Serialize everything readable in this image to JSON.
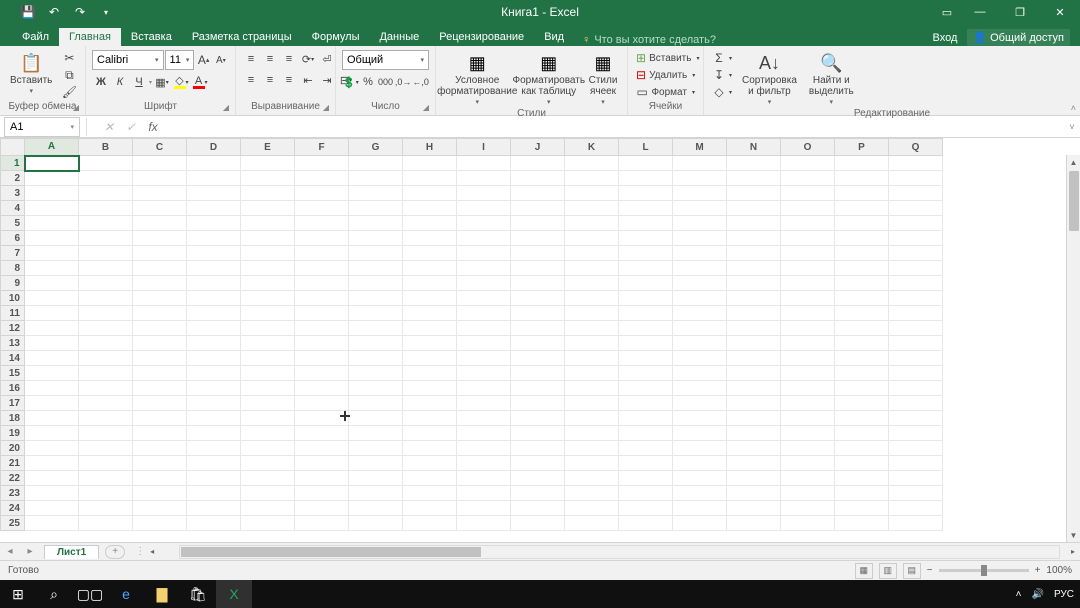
{
  "title": "Книга1 - Excel",
  "qat": {
    "save": "💾",
    "undo": "↶",
    "redo": "↷"
  },
  "win": {
    "ribbon_display": "▭",
    "min": "—",
    "max": "❐",
    "close": "✕"
  },
  "tabs": {
    "file": "Файл",
    "home": "Главная",
    "insert": "Вставка",
    "layout": "Разметка страницы",
    "formulas": "Формулы",
    "data": "Данные",
    "review": "Рецензирование",
    "view": "Вид"
  },
  "tell_me": "Что вы хотите сделать?",
  "signin": "Вход",
  "share": "Общий доступ",
  "ribbon": {
    "clipboard": {
      "paste": "Вставить",
      "cut": "",
      "copy": "",
      "format_painter": "",
      "label": "Буфер обмена"
    },
    "font": {
      "name": "Calibri",
      "size": "11",
      "bold": "Ж",
      "italic": "К",
      "underline": "Ч",
      "label": "Шрифт"
    },
    "alignment": {
      "label": "Выравнивание"
    },
    "number": {
      "format": "Общий",
      "label": "Число"
    },
    "styles": {
      "cf": "Условное\nформатирование",
      "table": "Форматировать\nкак таблицу",
      "cell": "Стили\nячеек",
      "label": "Стили"
    },
    "cells": {
      "insert": "Вставить",
      "delete": "Удалить",
      "format": "Формат",
      "label": "Ячейки"
    },
    "editing": {
      "sort": "Сортировка\nи фильтр",
      "find": "Найти и\nвыделить",
      "label": "Редактирование"
    }
  },
  "name_box": "A1",
  "columns": [
    "A",
    "B",
    "C",
    "D",
    "E",
    "F",
    "G",
    "H",
    "I",
    "J",
    "K",
    "L",
    "M",
    "N",
    "O",
    "P",
    "Q"
  ],
  "row_count": 25,
  "selected": {
    "row": 1,
    "col": "A"
  },
  "sheet_tab": "Лист1",
  "status": "Готово",
  "zoom": "100%",
  "tray": {
    "lang": "РУС"
  }
}
